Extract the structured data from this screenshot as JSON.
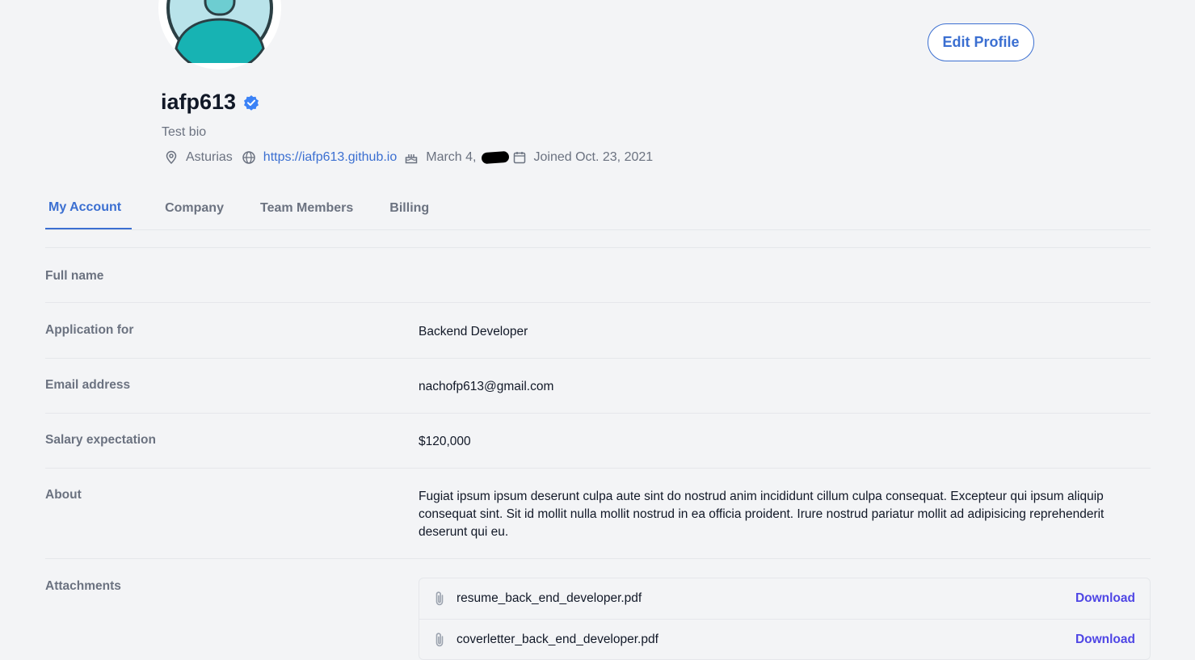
{
  "profile": {
    "username": "iafp613",
    "bio": "Test bio",
    "location": "Asturias",
    "website": "https://iafp613.github.io",
    "birthday": "March 4,",
    "joined": "Joined Oct. 23, 2021",
    "edit_label": "Edit Profile"
  },
  "tabs": [
    {
      "label": "My Account",
      "active": true
    },
    {
      "label": "Company",
      "active": false
    },
    {
      "label": "Team Members",
      "active": false
    },
    {
      "label": "Billing",
      "active": false
    }
  ],
  "fields": [
    {
      "label": "Full name",
      "value": ""
    },
    {
      "label": "Application for",
      "value": "Backend Developer"
    },
    {
      "label": "Email address",
      "value": "nachofp613@gmail.com"
    },
    {
      "label": "Salary expectation",
      "value": "$120,000"
    },
    {
      "label": "About",
      "value": "Fugiat ipsum ipsum deserunt culpa aute sint do nostrud anim incididunt cillum culpa consequat. Excepteur qui ipsum aliquip consequat sint. Sit id mollit nulla mollit nostrud in ea officia proident. Irure nostrud pariatur mollit ad adipisicing reprehenderit deserunt qui eu."
    }
  ],
  "attachments": {
    "label": "Attachments",
    "files": [
      {
        "name": "resume_back_end_developer.pdf",
        "action": "Download"
      },
      {
        "name": "coverletter_back_end_developer.pdf",
        "action": "Download"
      }
    ]
  },
  "colors": {
    "accent": "#3b6fd1",
    "download": "#4f46e5",
    "avatar_teal": "#17b3b3",
    "avatar_bg": "#b9e3ea"
  }
}
